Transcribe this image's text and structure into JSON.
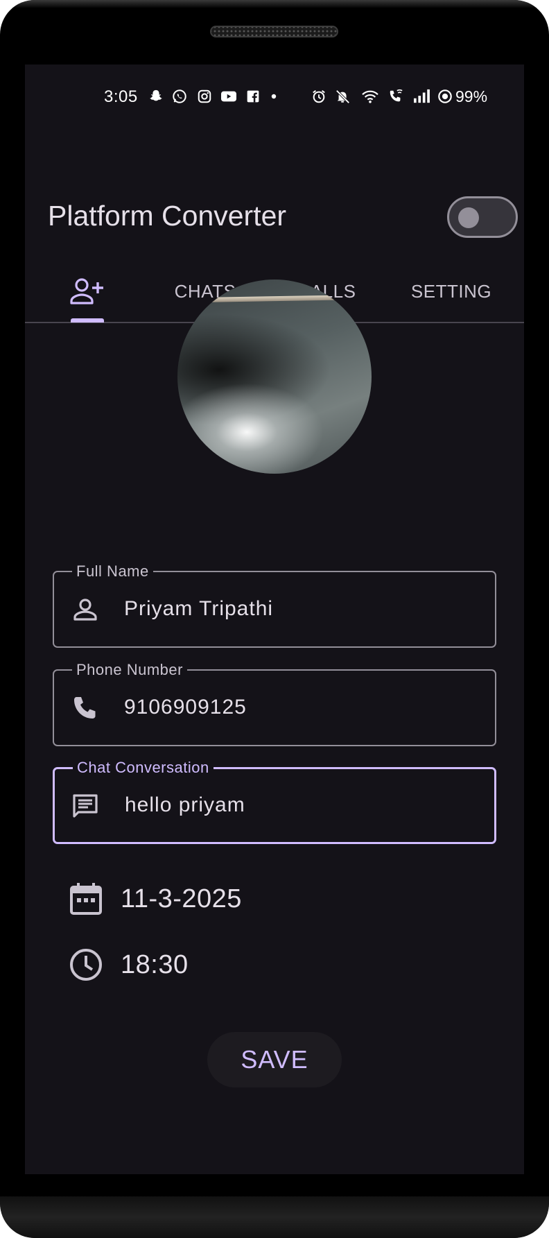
{
  "status_bar": {
    "time": "3:05",
    "battery": "99%",
    "left_icons": [
      "snapchat-icon",
      "whatsapp-icon",
      "instagram-icon",
      "youtube-icon",
      "facebook-icon",
      "dot-icon"
    ],
    "right_icons": [
      "alarm-icon",
      "mute-icon",
      "wifi-icon",
      "wifi-call-icon",
      "signal-icon",
      "data-saver-icon"
    ]
  },
  "app_bar": {
    "title": "Platform Converter",
    "theme_toggle_on": false
  },
  "tabs": [
    {
      "icon": "add-person-icon",
      "label": "",
      "selected": true
    },
    {
      "label": "CHATS",
      "selected": false
    },
    {
      "label": "CALLS",
      "selected": false
    },
    {
      "label": "SETTING",
      "selected": false
    }
  ],
  "form": {
    "full_name": {
      "label": "Full Name",
      "value": "Priyam Tripathi",
      "icon": "person-icon"
    },
    "phone": {
      "label": "Phone Number",
      "value": "9106909125",
      "icon": "phone-icon"
    },
    "chat": {
      "label": "Chat Conversation",
      "value": "hello priyam",
      "icon": "message-icon",
      "focused": true
    },
    "date": {
      "value": "11-3-2025",
      "icon": "calendar-icon"
    },
    "time": {
      "value": "18:30",
      "icon": "clock-icon"
    },
    "save_label": "SAVE"
  },
  "colors": {
    "background": "#141218",
    "primary": "#d0bcff",
    "on_surface": "#e6e0e9",
    "outline": "#938f99"
  }
}
